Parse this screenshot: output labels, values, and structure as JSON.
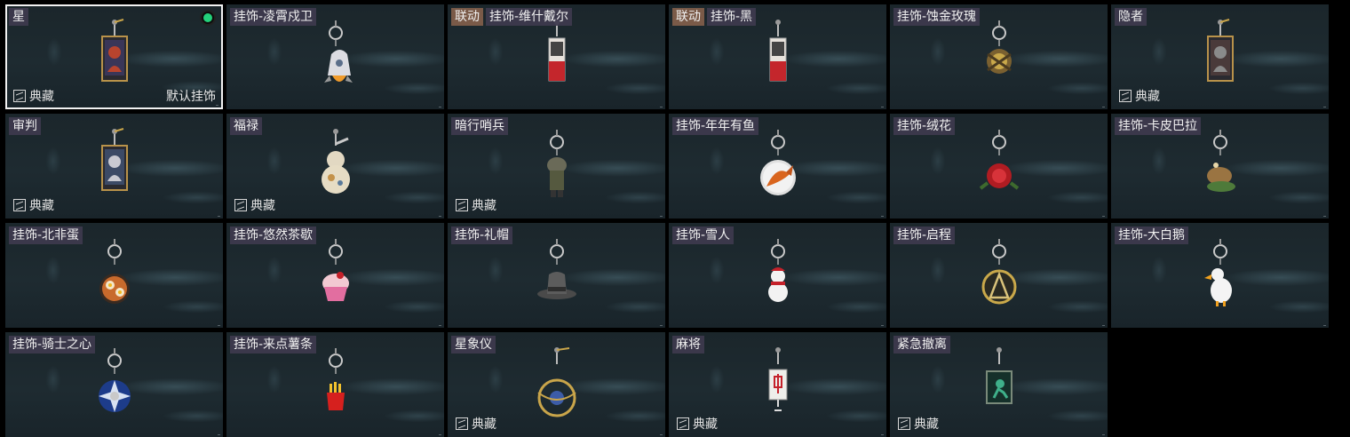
{
  "collection_label": "典藏",
  "default_label": "默认挂饰",
  "colors": {
    "tag_bg": "#3e3a4e",
    "collab_tag_bg": "#7a5a48",
    "equipped_dot": "#23d07a",
    "selected_border": "#f2f2f2"
  },
  "items": [
    {
      "tags": [
        {
          "text": "星",
          "type": "normal"
        }
      ],
      "collection": true,
      "default": true,
      "equipped": true,
      "selected": true,
      "icon": "star-tarot-card"
    },
    {
      "tags": [
        {
          "text": "挂饰-凌霄戍卫",
          "type": "normal"
        }
      ],
      "collection": false,
      "icon": "rocket-charm"
    },
    {
      "tags": [
        {
          "text": "联动",
          "type": "collab"
        },
        {
          "text": "挂饰-维什戴尔",
          "type": "normal"
        }
      ],
      "collection": false,
      "icon": "red-white-card-charm"
    },
    {
      "tags": [
        {
          "text": "联动",
          "type": "collab"
        },
        {
          "text": "挂饰-黑",
          "type": "normal"
        }
      ],
      "collection": false,
      "icon": "red-white-card-charm"
    },
    {
      "tags": [
        {
          "text": "挂饰-蚀金玫瑰",
          "type": "normal"
        }
      ],
      "collection": false,
      "icon": "gold-rose-charm"
    },
    {
      "tags": [
        {
          "text": "隐者",
          "type": "normal"
        }
      ],
      "collection": true,
      "icon": "hermit-tarot-card"
    },
    {
      "tags": [
        {
          "text": "审判",
          "type": "normal"
        }
      ],
      "collection": true,
      "icon": "judgement-tarot-card"
    },
    {
      "tags": [
        {
          "text": "福禄",
          "type": "normal"
        }
      ],
      "collection": true,
      "icon": "gourd-charm"
    },
    {
      "tags": [
        {
          "text": "暗行哨兵",
          "type": "normal"
        }
      ],
      "collection": true,
      "icon": "soldier-charm"
    },
    {
      "tags": [
        {
          "text": "挂饰-年年有鱼",
          "type": "normal"
        }
      ],
      "collection": false,
      "icon": "fish-charm"
    },
    {
      "tags": [
        {
          "text": "挂饰-绒花",
          "type": "normal"
        }
      ],
      "collection": false,
      "icon": "red-flower-charm"
    },
    {
      "tags": [
        {
          "text": "挂饰-卡皮巴拉",
          "type": "normal"
        }
      ],
      "collection": false,
      "icon": "capybara-charm"
    },
    {
      "tags": [
        {
          "text": "挂饰-北非蛋",
          "type": "normal"
        }
      ],
      "collection": false,
      "icon": "shakshuka-charm"
    },
    {
      "tags": [
        {
          "text": "挂饰-悠然茶歇",
          "type": "normal"
        }
      ],
      "collection": false,
      "icon": "cupcake-charm"
    },
    {
      "tags": [
        {
          "text": "挂饰-礼帽",
          "type": "normal"
        }
      ],
      "collection": false,
      "icon": "top-hat-charm"
    },
    {
      "tags": [
        {
          "text": "挂饰-雪人",
          "type": "normal"
        }
      ],
      "collection": false,
      "icon": "snowman-charm"
    },
    {
      "tags": [
        {
          "text": "挂饰-启程",
          "type": "normal"
        }
      ],
      "collection": false,
      "icon": "compass-medal-charm"
    },
    {
      "tags": [
        {
          "text": "挂饰-大白鹅",
          "type": "normal"
        }
      ],
      "collection": false,
      "icon": "goose-charm"
    },
    {
      "tags": [
        {
          "text": "挂饰-骑士之心",
          "type": "normal"
        }
      ],
      "collection": false,
      "icon": "knight-heart-charm"
    },
    {
      "tags": [
        {
          "text": "挂饰-来点薯条",
          "type": "normal"
        }
      ],
      "collection": false,
      "icon": "fries-charm"
    },
    {
      "tags": [
        {
          "text": "星象仪",
          "type": "normal"
        }
      ],
      "collection": true,
      "icon": "orrery-charm"
    },
    {
      "tags": [
        {
          "text": "麻将",
          "type": "normal"
        }
      ],
      "collection": true,
      "icon": "mahjong-tile-charm"
    },
    {
      "tags": [
        {
          "text": "紧急撤离",
          "type": "normal"
        }
      ],
      "collection": true,
      "icon": "evac-plaque-charm"
    }
  ]
}
